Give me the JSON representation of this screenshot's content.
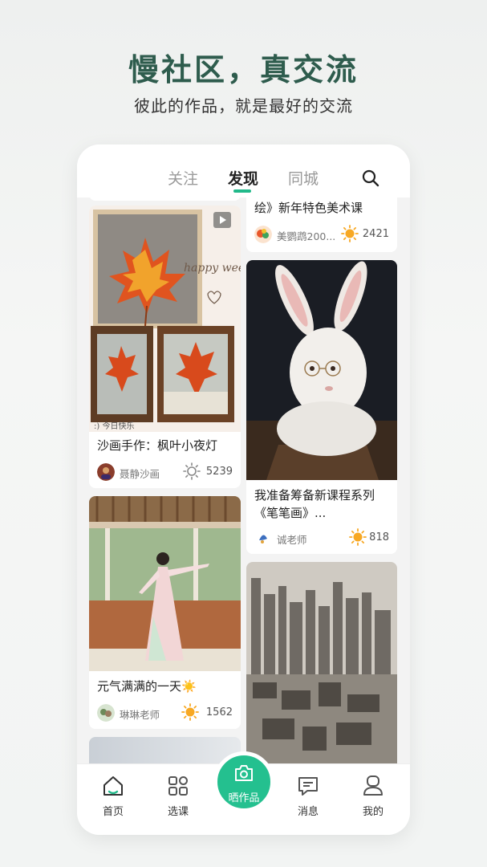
{
  "hero": {
    "title": "慢社区，真交流",
    "subtitle": "彼此的作品，就是最好的交流"
  },
  "tabs": [
    {
      "label": "关注",
      "active": false
    },
    {
      "label": "发现",
      "active": true
    },
    {
      "label": "同城",
      "active": false
    }
  ],
  "search_icon": "search-icon",
  "feed": {
    "left": [
      {
        "title": "沙画手作：枫叶小夜灯",
        "author": "聂静沙画",
        "likes": "5239",
        "has_video": true,
        "overlay_text": "happy weekend",
        "caption_text": ":) 今日快乐"
      },
      {
        "title": "元气满满的一天☀️",
        "author": "琳琳老师",
        "likes": "1562"
      }
    ],
    "right": [
      {
        "title": "绘》新年特色美术课",
        "author": "美鹦鹉200...",
        "likes": "2421"
      },
      {
        "title": "我准备筹备新课程系列《笔笔画》...",
        "author": "诚老师",
        "likes": "818"
      }
    ]
  },
  "bottom_nav": [
    {
      "label": "首页",
      "icon": "home-icon",
      "active": true
    },
    {
      "label": "选课",
      "icon": "grid-icon",
      "active": false
    },
    {
      "label": "晒作品",
      "icon": "camera-icon",
      "active": false
    },
    {
      "label": "消息",
      "icon": "message-icon",
      "active": false
    },
    {
      "label": "我的",
      "icon": "profile-icon",
      "active": false
    }
  ],
  "colors": {
    "accent": "#21b98a",
    "title": "#2e5c4d",
    "sun": "#f7a823"
  }
}
